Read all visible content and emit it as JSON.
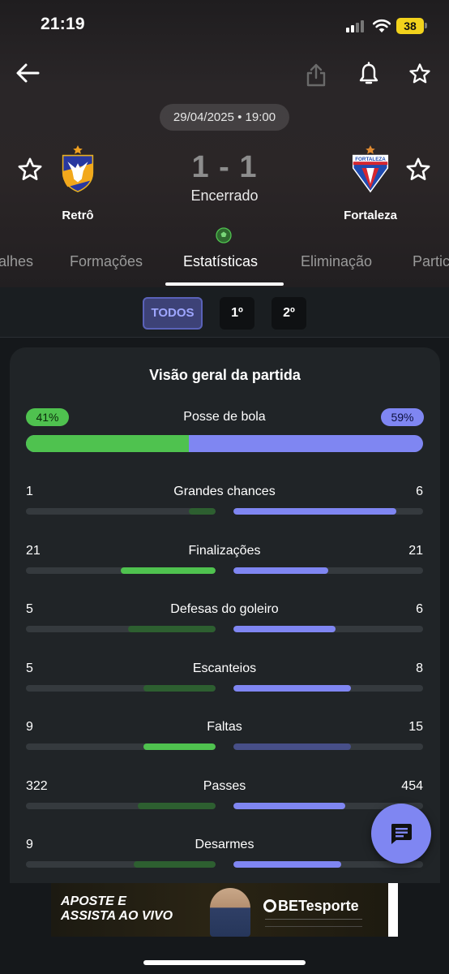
{
  "status_bar": {
    "time": "21:19",
    "battery": "38"
  },
  "header": {
    "date": "29/04/2025 • 19:00",
    "score": "1 - 1",
    "status": "Encerrado",
    "home_team": "Retrô",
    "away_team": "Fortaleza",
    "away_logo_text": "FORTALEZA"
  },
  "tabs": [
    "alhes",
    "Formações",
    "Estatísticas",
    "Eliminação",
    "Partic"
  ],
  "periods": {
    "all": "TODOS",
    "first": "1º",
    "second": "2º"
  },
  "overview": {
    "title": "Visão geral da partida",
    "possession": {
      "label": "Posse de bola",
      "home": "41%",
      "away": "59%",
      "home_fraction": 0.41
    },
    "stats": [
      {
        "label": "Grandes chances",
        "home": "1",
        "away": "6",
        "home_fill": 0.14,
        "away_fill": 0.86,
        "home_color": "#2d5f30",
        "away_color": "#7f86f2"
      },
      {
        "label": "Finalizações",
        "home": "21",
        "away": "21",
        "home_fill": 0.5,
        "away_fill": 0.5,
        "home_color": "#4fc24f",
        "away_color": "#7f86f2"
      },
      {
        "label": "Defesas do goleiro",
        "home": "5",
        "away": "6",
        "home_fill": 0.46,
        "away_fill": 0.54,
        "home_color": "#2d5f30",
        "away_color": "#7f86f2"
      },
      {
        "label": "Escanteios",
        "home": "5",
        "away": "8",
        "home_fill": 0.38,
        "away_fill": 0.62,
        "home_color": "#2d5f30",
        "away_color": "#7f86f2"
      },
      {
        "label": "Faltas",
        "home": "9",
        "away": "15",
        "home_fill": 0.38,
        "away_fill": 0.62,
        "home_color": "#4fc24f",
        "away_color": "#474f88"
      },
      {
        "label": "Passes",
        "home": "322",
        "away": "454",
        "home_fill": 0.41,
        "away_fill": 0.59,
        "home_color": "#2d5f30",
        "away_color": "#7f86f2"
      },
      {
        "label": "Desarmes",
        "home": "9",
        "away": "",
        "home_fill": 0.43,
        "away_fill": 0.57,
        "home_color": "#2d5f30",
        "away_color": "#7f86f2"
      }
    ]
  },
  "ad": {
    "headline_1": "APOSTE E",
    "headline_2": "ASSISTA AO VIVO",
    "brand": "BETesporte"
  },
  "colors": {
    "home_accent": "#4fc24f",
    "away_accent": "#7f86f2",
    "card_bg": "#202427"
  }
}
